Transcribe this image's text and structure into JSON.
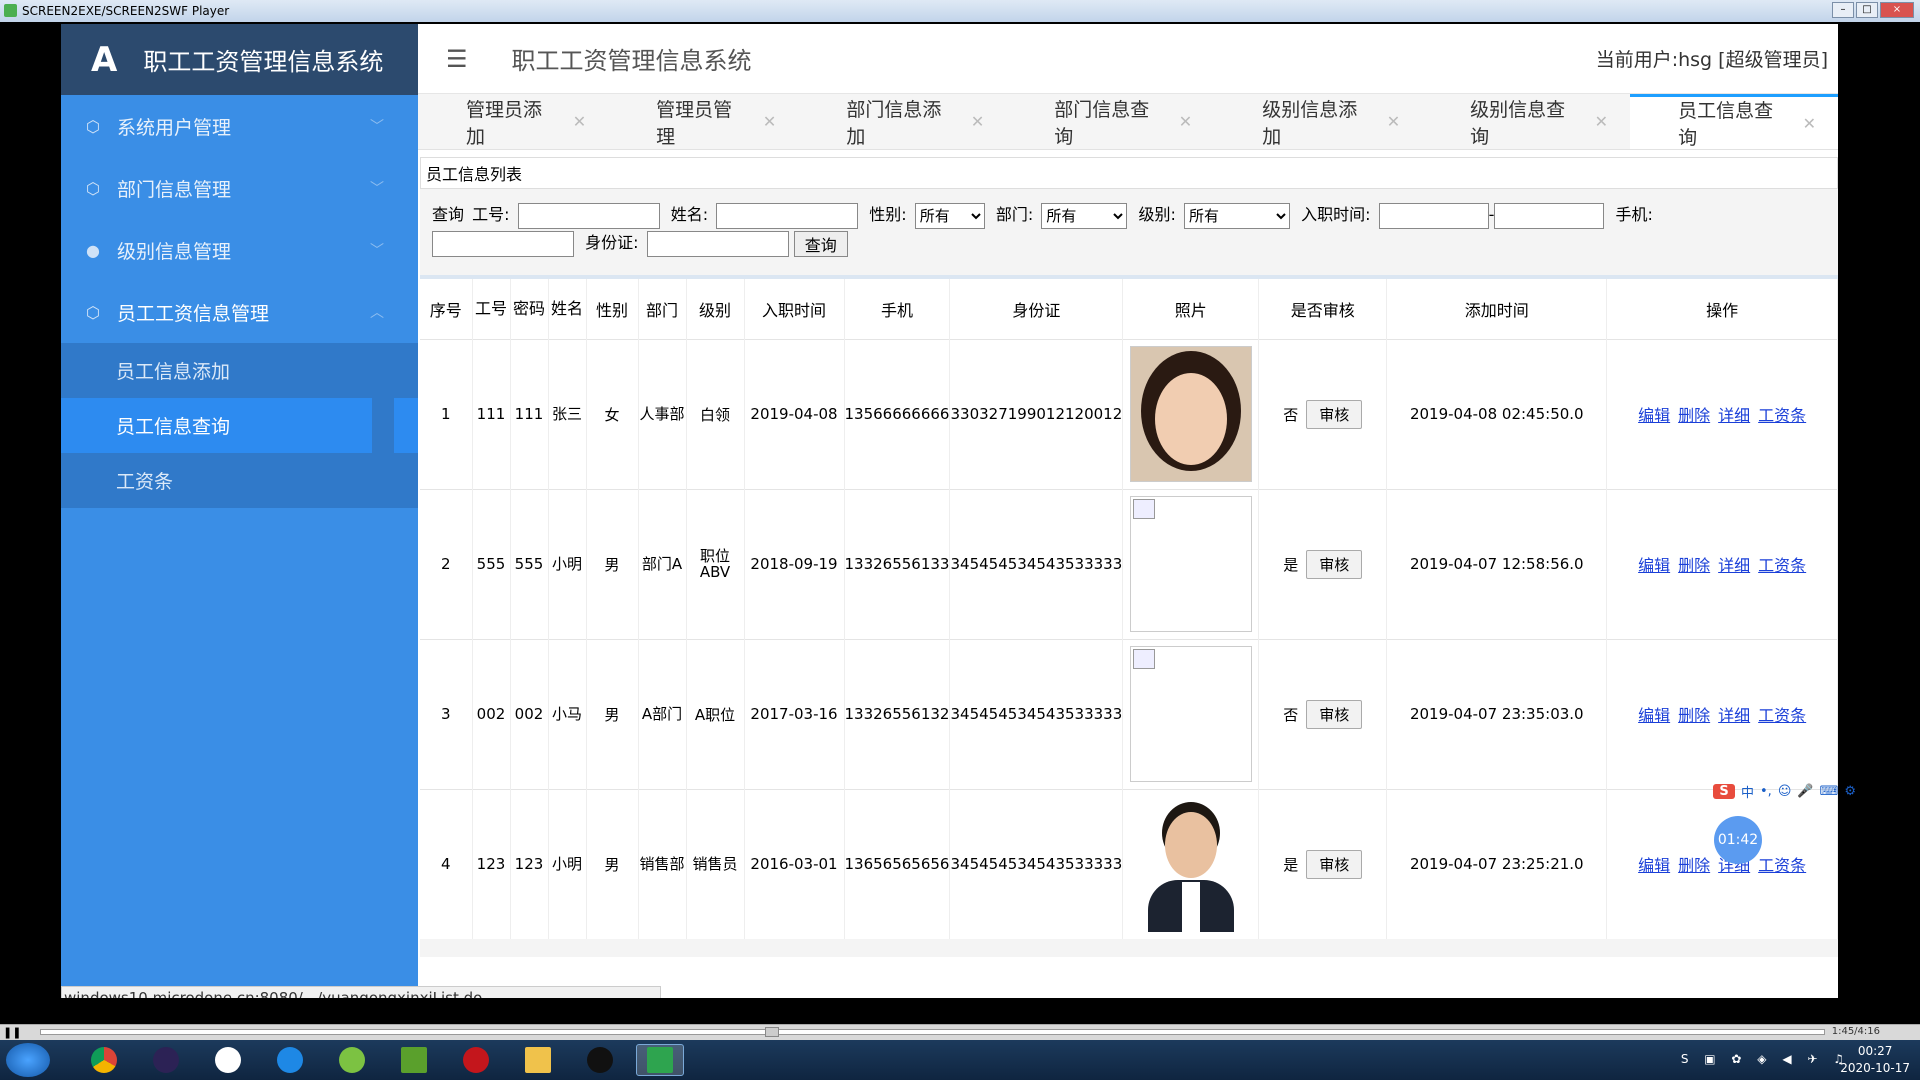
{
  "player": {
    "title": "SCREEN2EXE/SCREEN2SWF Player"
  },
  "app": {
    "brand_logo": "A",
    "brand_title": "职工工资管理信息系统",
    "header_title": "职工工资管理信息系统",
    "current_user": "当前用户:hsg [超级管理员]"
  },
  "sidebar": {
    "menus": [
      {
        "label": "系统用户管理",
        "icon": "cube-icon"
      },
      {
        "label": "部门信息管理",
        "icon": "cube-icon"
      },
      {
        "label": "级别信息管理",
        "icon": "user-icon"
      },
      {
        "label": "员工工资信息管理",
        "icon": "cube-icon"
      }
    ],
    "sub": [
      {
        "label": "员工信息添加"
      },
      {
        "label": "员工信息查询"
      },
      {
        "label": "工资条"
      }
    ]
  },
  "tabs": [
    "管理员添加",
    "管理员管理",
    "部门信息添加",
    "部门信息查询",
    "级别信息添加",
    "级别信息查询",
    "员工信息查询"
  ],
  "panel": {
    "title": "员工信息列表"
  },
  "search": {
    "prefix": "查询",
    "gonghao_label": "工号:",
    "name_label": "姓名:",
    "gender_label": "性别:",
    "gender_value": "所有",
    "dept_label": "部门:",
    "dept_value": "所有",
    "level_label": "级别:",
    "level_value": "所有",
    "join_label": "入职时间:",
    "join_sep": "-",
    "phone_label": "手机:",
    "id_label": "身份证:",
    "button": "查询"
  },
  "table": {
    "headers": [
      "序号",
      "工号",
      "密码",
      "姓名",
      "性别",
      "部门",
      "级别",
      "入职时间",
      "手机",
      "身份证",
      "照片",
      "是否审核",
      "添加时间",
      "操作"
    ],
    "rows": [
      {
        "no": "1",
        "gonghao": "111",
        "mima": "111",
        "name": "张三",
        "gender": "女",
        "dept": "人事部",
        "level": "白领",
        "join": "2019-04-08",
        "phone": "13566666666",
        "idcard": "330327199012120012",
        "photo": "woman",
        "audited": "否",
        "added": "2019-04-08 02:45:50.0"
      },
      {
        "no": "2",
        "gonghao": "555",
        "mima": "555",
        "name": "小明",
        "gender": "男",
        "dept": "部门A",
        "level": "职位ABV",
        "join": "2018-09-19",
        "phone": "13326556133",
        "idcard": "345454534543533333",
        "photo": "broken",
        "audited": "是",
        "added": "2019-04-07 12:58:56.0"
      },
      {
        "no": "3",
        "gonghao": "002",
        "mima": "002",
        "name": "小马",
        "gender": "男",
        "dept": "A部门",
        "level": "A职位",
        "join": "2017-03-16",
        "phone": "13326556132",
        "idcard": "345454534543533333",
        "photo": "broken",
        "audited": "否",
        "added": "2019-04-07 23:35:03.0"
      },
      {
        "no": "4",
        "gonghao": "123",
        "mima": "123",
        "name": "小明",
        "gender": "男",
        "dept": "销售部",
        "level": "销售员",
        "join": "2016-03-01",
        "phone": "13656565656",
        "idcard": "345454534543533333",
        "photo": "man",
        "audited": "是",
        "added": "2019-04-07 23:25:21.0"
      }
    ],
    "audit_button": "审核",
    "ops": [
      "编辑",
      "删除",
      "详细",
      "工资条"
    ]
  },
  "statusbar": {
    "url": "windows10.microdone.cn:8080/.../yuangongxinxiList.do"
  },
  "overlay": {
    "timer": "01:42",
    "ime_lang": "中"
  },
  "player_bar": {
    "time": "1:45/4:16"
  },
  "taskbar": {
    "time": "00:27",
    "date": "2020-10-17"
  },
  "colors": {
    "sidebar": "#3a8ee6",
    "brand": "#2c4a6e",
    "link": "#1a3fd8",
    "active_tab": "#1e9fff"
  }
}
